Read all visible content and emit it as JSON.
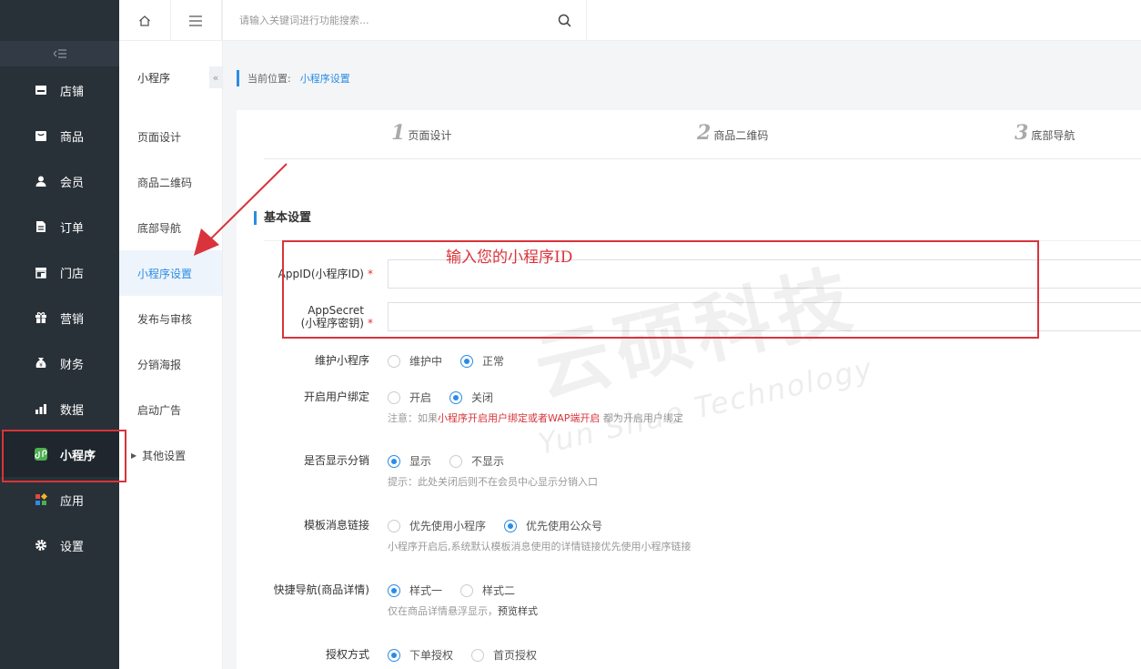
{
  "sidebar": {
    "items": [
      {
        "label": "店铺",
        "icon": "store-icon"
      },
      {
        "label": "商品",
        "icon": "goods-icon"
      },
      {
        "label": "会员",
        "icon": "user-icon"
      },
      {
        "label": "订单",
        "icon": "order-icon"
      },
      {
        "label": "门店",
        "icon": "shop-icon"
      },
      {
        "label": "营销",
        "icon": "gift-icon"
      },
      {
        "label": "财务",
        "icon": "money-bag-icon"
      },
      {
        "label": "数据",
        "icon": "bar-chart-icon"
      },
      {
        "label": "小程序",
        "icon": "mini-program-icon"
      },
      {
        "label": "应用",
        "icon": "apps-icon"
      },
      {
        "label": "设置",
        "icon": "gear-icon"
      }
    ]
  },
  "subnav": {
    "title": "小程序",
    "items": [
      "页面设计",
      "商品二维码",
      "底部导航",
      "小程序设置",
      "发布与审核",
      "分销海报",
      "启动广告"
    ],
    "other": "其他设置"
  },
  "topbar": {
    "search_placeholder": "请输入关键词进行功能搜索..."
  },
  "breadcrumb": {
    "prefix": "当前位置:",
    "current": "小程序设置"
  },
  "steps": [
    {
      "num": "1",
      "label": "页面设计"
    },
    {
      "num": "2",
      "label": "商品二维码"
    },
    {
      "num": "3",
      "label": "底部导航"
    }
  ],
  "form": {
    "section_title": "基本设置",
    "annotation": "输入您的小程序ID",
    "appid_label": "AppID(小程序ID)",
    "appsecret_label_1": "AppSecret",
    "appsecret_label_2": "(小程序密钥)",
    "required_mark": "*",
    "maintain": {
      "label": "维护小程序",
      "opt1": "维护中",
      "opt2": "正常"
    },
    "binding": {
      "label": "开启用户绑定",
      "opt1": "开启",
      "opt2": "关闭",
      "hint_pre": "注意：如果",
      "hint_red": "小程序开启用户绑定或者WAP端开启",
      "hint_post": " 都为开启用户绑定"
    },
    "distribution": {
      "label": "是否显示分销",
      "opt1": "显示",
      "opt2": "不显示",
      "hint": "提示：此处关闭后则不在会员中心显示分销入口"
    },
    "template_link": {
      "label": "模板消息链接",
      "opt1": "优先使用小程序",
      "opt2": "优先使用公众号",
      "hint": "小程序开启后,系统默认模板消息使用的详情链接优先使用小程序链接"
    },
    "quick_nav": {
      "label": "快捷导航(商品详情)",
      "opt1": "样式一",
      "opt2": "样式二",
      "hint_pre": "仅在商品详情悬浮显示，",
      "hint_link": "预览样式"
    },
    "auth": {
      "label": "授权方式",
      "opt1": "下单授权",
      "opt2": "首页授权"
    }
  },
  "watermark": {
    "big": "云硕科技",
    "small": "Yun Shuo Technology"
  }
}
